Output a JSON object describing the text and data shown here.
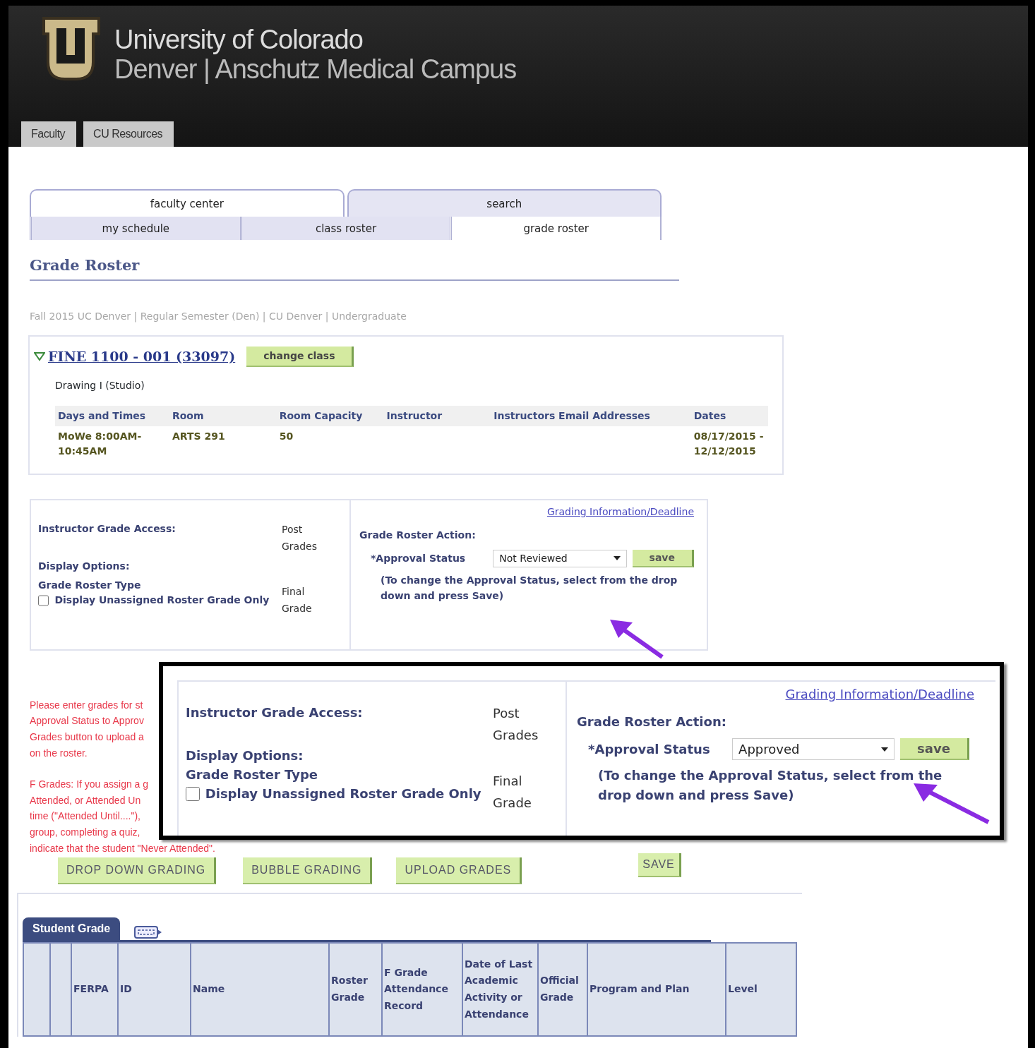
{
  "header": {
    "title_line1": "University of Colorado",
    "title_line2": "Denver | Anschutz Medical Campus",
    "nav_tabs": [
      {
        "label": "Faculty"
      },
      {
        "label": "CU Resources"
      }
    ]
  },
  "primary_tabs": [
    {
      "label": "faculty center",
      "selected": true
    },
    {
      "label": "search",
      "selected": false
    }
  ],
  "secondary_tabs": [
    {
      "label": "my schedule",
      "selected": false
    },
    {
      "label": "class roster",
      "selected": false
    },
    {
      "label": "grade roster",
      "selected": true
    }
  ],
  "page_title": "Grade Roster",
  "term_info": "Fall 2015 UC Denver | Regular Semester (Den) | CU Denver | Undergraduate",
  "class": {
    "expanded": true,
    "link": "FINE 1100 - 001 (33097)",
    "change_button": "change class",
    "description": "Drawing I (Studio)",
    "columns": [
      "Days and Times",
      "Room",
      "Room Capacity",
      "Instructor",
      "Instructors Email Addresses",
      "Dates"
    ],
    "rows": [
      [
        "MoWe 8:00AM-10:45AM",
        "ARTS 291",
        "50",
        null,
        null,
        "08/17/2015 - 12/12/2015"
      ]
    ]
  },
  "action_panel": {
    "access_label": "Instructor Grade Access:",
    "access_value": "Post Grades",
    "display_options_label": "Display Options:",
    "roster_type_label": "Grade Roster Type",
    "roster_type_value": "Final Grade",
    "unassigned_only": {
      "label": "Display Unassigned Roster Grade Only",
      "checked": false
    },
    "info_link": "Grading Information/Deadline",
    "action_label": "Grade Roster Action:",
    "approval_status_label": "*Approval Status",
    "approval_status_value": "Not Reviewed",
    "save_button": "save",
    "hint": "(To change the Approval Status, select from the drop down and press Save)"
  },
  "instructions": [
    "Please enter grades for st",
    "Approval Status to Approv",
    "Grades button to upload a",
    "on the roster.",
    "F Grades: If you assign a g",
    "Attended, or Attended Un",
    "time (\"Attended Until....\"),",
    "group, completing a quiz,",
    "indicate that the student \"Never Attended\"."
  ],
  "grading_buttons": [
    "DROP DOWN GRADING",
    "BUBBLE GRADING",
    "UPLOAD GRADES"
  ],
  "save_button": "SAVE",
  "student_grid": {
    "tab": "Student Grade",
    "columns": [
      "FERPA",
      "ID",
      "Name",
      "Roster Grade",
      "F Grade Attendance Record",
      "Date of Last Academic Activity or Attendance",
      "Official Grade",
      "Program and Plan",
      "Level"
    ]
  },
  "zoom_inset": {
    "access_label": "Instructor Grade Access:",
    "access_value": "Post Grades",
    "display_options_label": "Display Options:",
    "roster_type_label": "Grade Roster Type",
    "roster_type_value": "Final Grade",
    "unassigned_only": {
      "label": "Display Unassigned Roster Grade Only",
      "checked": false
    },
    "info_link": "Grading Information/Deadline",
    "action_label": "Grade Roster Action:",
    "approval_status_label": "*Approval Status",
    "approval_status_value": "Approved",
    "save_button": "save",
    "hint": "(To change the Approval Status, select from the drop down and press Save)"
  }
}
